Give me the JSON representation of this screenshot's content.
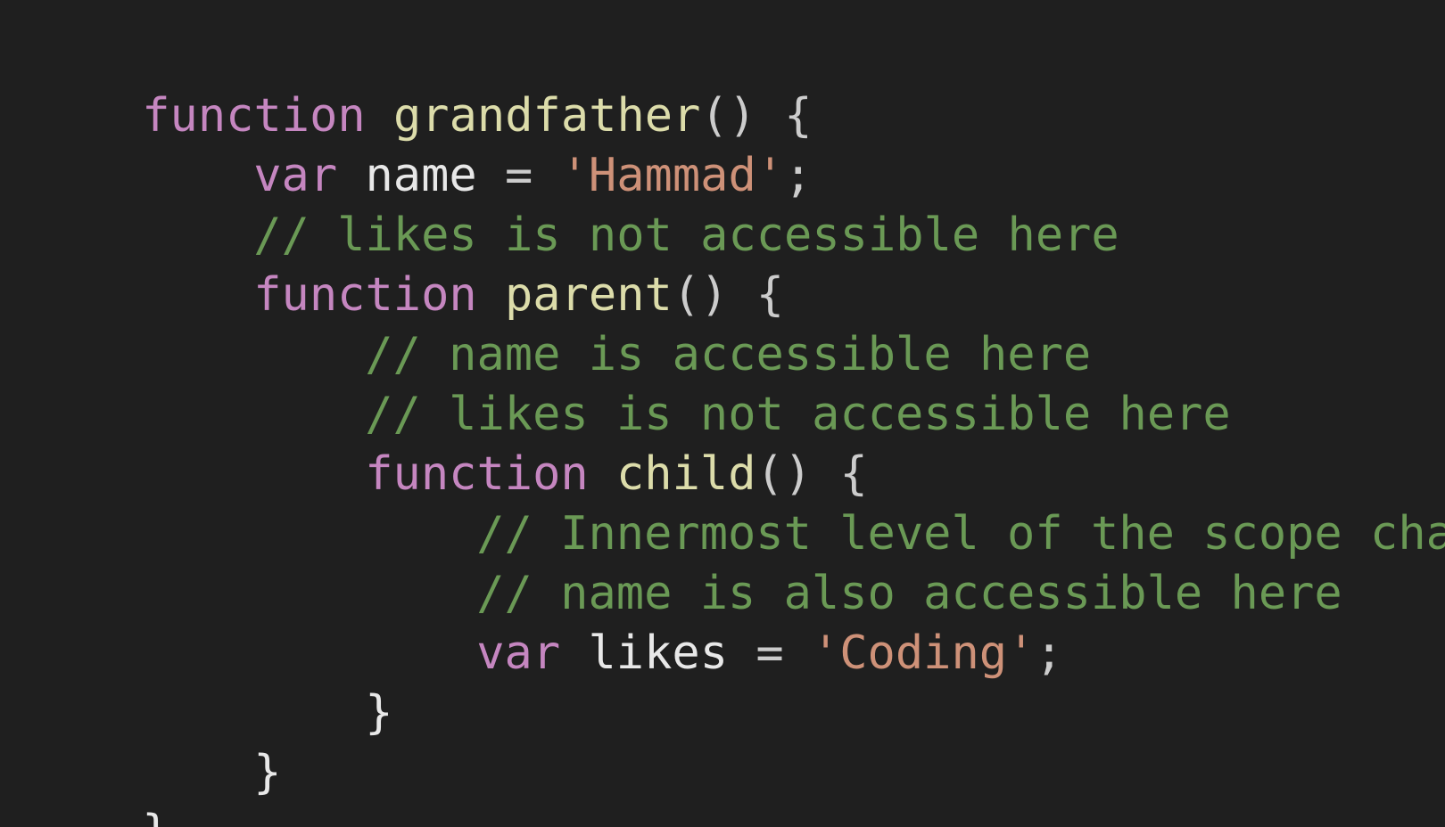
{
  "code_lines": [
    {
      "tokens": [
        {
          "type": "keyword",
          "text": "function"
        },
        {
          "type": "space",
          "text": " "
        },
        {
          "type": "func",
          "text": "grandfather"
        },
        {
          "type": "punct",
          "text": "() {"
        }
      ]
    },
    {
      "tokens": [
        {
          "type": "keyword",
          "text": "var"
        },
        {
          "type": "space",
          "text": " "
        },
        {
          "type": "ident",
          "text": "name"
        },
        {
          "type": "punct",
          "text": " = "
        },
        {
          "type": "string",
          "text": "'Hammad'"
        },
        {
          "type": "punct",
          "text": ";"
        }
      ]
    },
    {
      "tokens": [
        {
          "type": "comment",
          "text": "// likes is not accessible here"
        }
      ]
    },
    {
      "tokens": [
        {
          "type": "keyword",
          "text": "function"
        },
        {
          "type": "space",
          "text": " "
        },
        {
          "type": "func",
          "text": "parent"
        },
        {
          "type": "punct",
          "text": "() {"
        }
      ]
    },
    {
      "tokens": [
        {
          "type": "comment",
          "text": "// name is accessible here"
        }
      ]
    },
    {
      "tokens": [
        {
          "type": "comment",
          "text": "// likes is not accessible here"
        }
      ]
    },
    {
      "tokens": [
        {
          "type": "keyword",
          "text": "function"
        },
        {
          "type": "space",
          "text": " "
        },
        {
          "type": "func",
          "text": "child"
        },
        {
          "type": "punct",
          "text": "() {"
        }
      ]
    },
    {
      "tokens": [
        {
          "type": "comment",
          "text": "// Innermost level of the scope chain"
        }
      ]
    },
    {
      "tokens": [
        {
          "type": "comment",
          "text": "// name is also accessible here"
        }
      ]
    },
    {
      "tokens": [
        {
          "type": "keyword",
          "text": "var"
        },
        {
          "type": "space",
          "text": " "
        },
        {
          "type": "ident",
          "text": "likes"
        },
        {
          "type": "punct",
          "text": " = "
        },
        {
          "type": "string",
          "text": "'Coding'"
        },
        {
          "type": "punct",
          "text": ";"
        }
      ]
    },
    {
      "tokens": [
        {
          "type": "brace",
          "text": "}"
        }
      ]
    },
    {
      "tokens": [
        {
          "type": "brace",
          "text": "}"
        }
      ]
    },
    {
      "tokens": [
        {
          "type": "brace",
          "text": "}"
        }
      ]
    }
  ],
  "colors": {
    "background": "#1f1f1f",
    "keyword": "#c586c0",
    "function_name": "#dcdcaa",
    "identifier": "#e8e8e8",
    "string": "#ce9178",
    "comment": "#6a9955",
    "punctuation": "#cccccc"
  }
}
